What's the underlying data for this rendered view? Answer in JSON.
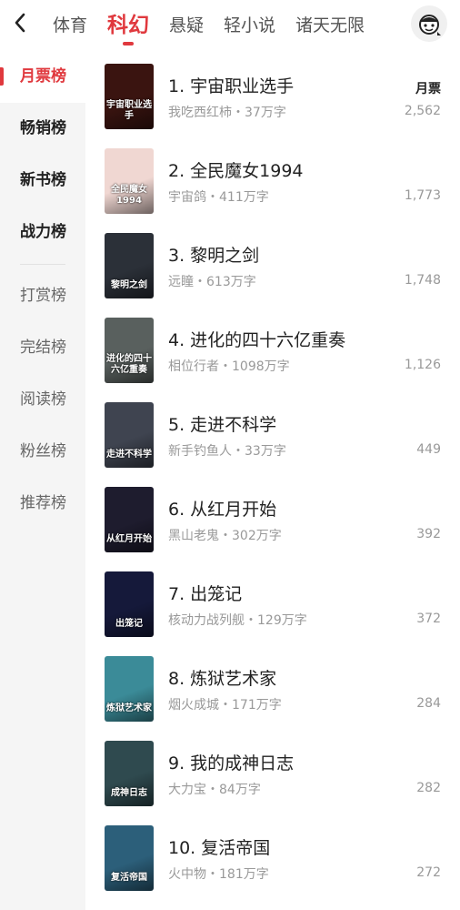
{
  "header": {
    "tabs": [
      {
        "label": "体育"
      },
      {
        "label": "科幻"
      },
      {
        "label": "悬疑"
      },
      {
        "label": "轻小说"
      },
      {
        "label": "诸天无限"
      }
    ]
  },
  "sidebar": {
    "items": [
      {
        "label": "月票榜"
      },
      {
        "label": "畅销榜"
      },
      {
        "label": "新书榜"
      },
      {
        "label": "战力榜"
      },
      {
        "label": "打赏榜"
      },
      {
        "label": "完结榜"
      },
      {
        "label": "阅读榜"
      },
      {
        "label": "粉丝榜"
      },
      {
        "label": "推荐榜"
      }
    ]
  },
  "list": {
    "column_header": "月票",
    "books": [
      {
        "title": "1. 宇宙职业选手",
        "meta": "我吃西红柿・37万字",
        "count": "2,562",
        "cover_text": "宇宙职业选手",
        "cover_color": "#3a1410"
      },
      {
        "title": "2. 全民魔女1994",
        "meta": "宇宙鸽・411万字",
        "count": "1,773",
        "cover_text": "全民魔女1994",
        "cover_color": "#f0d7d2"
      },
      {
        "title": "3. 黎明之剑",
        "meta": "远瞳・613万字",
        "count": "1,748",
        "cover_text": "黎明之剑",
        "cover_color": "#2b3038"
      },
      {
        "title": "4. 进化的四十六亿重奏",
        "meta": "相位行者・1098万字",
        "count": "1,126",
        "cover_text": "进化的四十六亿重奏",
        "cover_color": "#59605e"
      },
      {
        "title": "5. 走进不科学",
        "meta": "新手钓鱼人・33万字",
        "count": "449",
        "cover_text": "走进不科学",
        "cover_color": "#3f4450"
      },
      {
        "title": "6. 从红月开始",
        "meta": "黑山老鬼・302万字",
        "count": "392",
        "cover_text": "从红月开始",
        "cover_color": "#1e1c2e"
      },
      {
        "title": "7. 出笼记",
        "meta": "核动力战列舰・129万字",
        "count": "372",
        "cover_text": "出笼记",
        "cover_color": "#15193a"
      },
      {
        "title": "8. 炼狱艺术家",
        "meta": "烟火成城・171万字",
        "count": "284",
        "cover_text": "炼狱艺术家",
        "cover_color": "#3b8b98"
      },
      {
        "title": "9. 我的成神日志",
        "meta": "大力宝・84万字",
        "count": "282",
        "cover_text": "成神日志",
        "cover_color": "#2f4a4f"
      },
      {
        "title": "10. 复活帝国",
        "meta": "火中物・181万字",
        "count": "272",
        "cover_text": "复活帝国",
        "cover_color": "#2c5f7a"
      }
    ]
  },
  "colors": {
    "accent": "#e0393e",
    "sidebar_bg": "#f5f5f5",
    "meta_text": "#999999"
  },
  "icons": {
    "back": "back-arrow-icon",
    "avatar": "user-avatar-icon"
  }
}
